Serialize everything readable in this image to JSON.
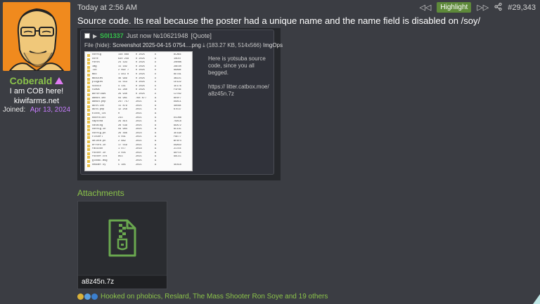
{
  "user": {
    "name": "Coberald",
    "title": "I am COB here!",
    "site": "kiwifarms.net",
    "joined_label": "Joined:",
    "joined_date": "Apr 13, 2024"
  },
  "post": {
    "date": "Today at 2:56 AM",
    "highlight_label": "Highlight",
    "number": "#29,343",
    "body": "Source code. Its real because the poster had a unique name and the name field is disabled on /soy/"
  },
  "embed": {
    "poster": "S0I1337",
    "meta": "Just now №10621948",
    "quote": "[Quote]",
    "file_label": "File",
    "hide": "(hide)",
    "filename": "Screenshot 2025-04-15 0754....png",
    "filesize": "(183.27 KB, 514x566)",
    "imgops": "ImgOps",
    "text_1": "Here is yotsuba source code, since you all begged.",
    "text_2": "https:// litter.catbox.moe/ a8z45n.7z",
    "thumb_rows": [
      [
        "config",
        "148 868",
        "0 2025",
        "D",
        "8CAKE"
      ],
      [
        "core",
        "630 258",
        "0 2025",
        "D",
        "10DUT"
      ],
      [
        "fonts",
        "24 193",
        "0 2025",
        "D",
        "20RNN"
      ],
      [
        "img",
        "11 182",
        "0 2025",
        "D",
        "28E4R"
      ],
      [
        "lib",
        "2 692 7",
        "0 2025",
        "D",
        "9AA8E"
      ],
      [
        "mod",
        "1 953 0",
        "0 2025",
        "D",
        "8D7A1"
      ],
      [
        "modules",
        "46 999",
        "0 2025",
        "D",
        "3B22C"
      ],
      [
        "plugins",
        "11 553",
        "0 2025",
        "D",
        "CE122"
      ],
      [
        "static",
        "4 141",
        "0 2025",
        "D",
        "1E176"
      ],
      [
        "views",
        "91 260",
        "0 2025",
        "D",
        "F4F8E"
      ],
      [
        "workflows",
        "26 930",
        "0 2025",
        "D",
        "C27B2"
      ],
      [
        "admin.inc",
        "59 981",
        "768 877",
        "A",
        "8E6F7"
      ],
      [
        "admin.php",
        "247 757",
        "2021",
        "A",
        "D98C1"
      ],
      [
        "auth.inc",
        "11 879",
        "2025",
        "A",
        "4809E"
      ],
      [
        "auto.php",
        "12 258",
        "2021",
        "A",
        "67E37"
      ],
      [
        "block_lis",
        "0",
        "2021",
        "A",
        ""
      ],
      [
        "boardlist",
        "233",
        "2021",
        "A",
        "DCD8B"
      ],
      [
        "captcha",
        "29 815",
        "2021",
        "A",
        "798C8"
      ],
      [
        "catalog",
        "28 539",
        "2025",
        "A",
        "9DA72"
      ],
      [
        "config.in",
        "59 984",
        "2025",
        "A",
        "9C13C"
      ],
      [
        "config.ph",
        "26 466",
        "2024",
        "A",
        "3E19A"
      ],
      [
        "cloudfl",
        "4 031",
        "2021",
        "A",
        "FAE77"
      ],
      [
        "delete.ph",
        "2 882",
        "2021",
        "A",
        "BF8F4"
      ],
      [
        "errors.in",
        "17 559",
        "2021",
        "A",
        "D9A5D"
      ],
      [
        "favicon",
        "1 077",
        "2018",
        "A",
        "217EE"
      ],
      [
        "footer.in",
        "3 035",
        "2021",
        "A",
        "9EF15"
      ],
      [
        "footer.txt",
        "853",
        "2021",
        "A",
        "99C1C"
      ],
      [
        "global.msg",
        "0",
        "2025",
        "A",
        ""
      ],
      [
        "header.sy",
        "5 385",
        "2021",
        "A",
        "4E818"
      ]
    ]
  },
  "attachments": {
    "title": "Attachments",
    "items": [
      {
        "name": "a8z45n.7z"
      }
    ]
  },
  "reactions": {
    "text": "Hooked on phobics, Reslard, The Mass Shooter Ron Soye and 19 others"
  },
  "colors": {
    "accent_green": "#8bc34a",
    "poster_green": "#35c04a",
    "highlight_bg": "#5e8a3a",
    "avatar_bg": "#f08a1e",
    "joined_date": "#c77dff",
    "page_bg": "#3b3d43"
  }
}
